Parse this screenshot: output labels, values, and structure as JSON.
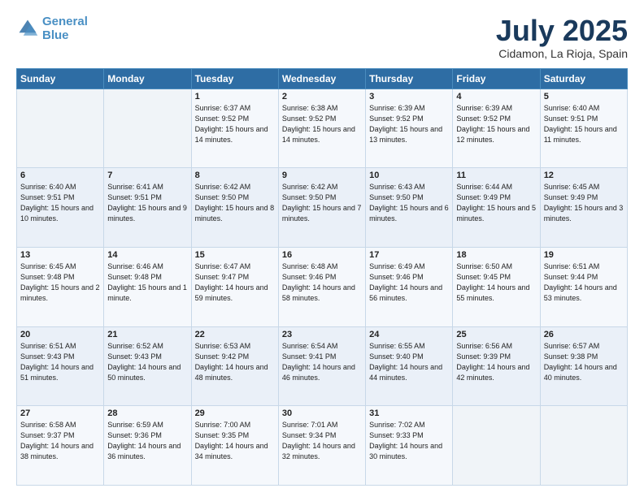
{
  "logo": {
    "text_general": "General",
    "text_blue": "Blue"
  },
  "header": {
    "month": "July 2025",
    "location": "Cidamon, La Rioja, Spain"
  },
  "days_of_week": [
    "Sunday",
    "Monday",
    "Tuesday",
    "Wednesday",
    "Thursday",
    "Friday",
    "Saturday"
  ],
  "weeks": [
    [
      {
        "day": "",
        "sunrise": "",
        "sunset": "",
        "daylight": ""
      },
      {
        "day": "",
        "sunrise": "",
        "sunset": "",
        "daylight": ""
      },
      {
        "day": "1",
        "sunrise": "Sunrise: 6:37 AM",
        "sunset": "Sunset: 9:52 PM",
        "daylight": "Daylight: 15 hours and 14 minutes."
      },
      {
        "day": "2",
        "sunrise": "Sunrise: 6:38 AM",
        "sunset": "Sunset: 9:52 PM",
        "daylight": "Daylight: 15 hours and 14 minutes."
      },
      {
        "day": "3",
        "sunrise": "Sunrise: 6:39 AM",
        "sunset": "Sunset: 9:52 PM",
        "daylight": "Daylight: 15 hours and 13 minutes."
      },
      {
        "day": "4",
        "sunrise": "Sunrise: 6:39 AM",
        "sunset": "Sunset: 9:52 PM",
        "daylight": "Daylight: 15 hours and 12 minutes."
      },
      {
        "day": "5",
        "sunrise": "Sunrise: 6:40 AM",
        "sunset": "Sunset: 9:51 PM",
        "daylight": "Daylight: 15 hours and 11 minutes."
      }
    ],
    [
      {
        "day": "6",
        "sunrise": "Sunrise: 6:40 AM",
        "sunset": "Sunset: 9:51 PM",
        "daylight": "Daylight: 15 hours and 10 minutes."
      },
      {
        "day": "7",
        "sunrise": "Sunrise: 6:41 AM",
        "sunset": "Sunset: 9:51 PM",
        "daylight": "Daylight: 15 hours and 9 minutes."
      },
      {
        "day": "8",
        "sunrise": "Sunrise: 6:42 AM",
        "sunset": "Sunset: 9:50 PM",
        "daylight": "Daylight: 15 hours and 8 minutes."
      },
      {
        "day": "9",
        "sunrise": "Sunrise: 6:42 AM",
        "sunset": "Sunset: 9:50 PM",
        "daylight": "Daylight: 15 hours and 7 minutes."
      },
      {
        "day": "10",
        "sunrise": "Sunrise: 6:43 AM",
        "sunset": "Sunset: 9:50 PM",
        "daylight": "Daylight: 15 hours and 6 minutes."
      },
      {
        "day": "11",
        "sunrise": "Sunrise: 6:44 AM",
        "sunset": "Sunset: 9:49 PM",
        "daylight": "Daylight: 15 hours and 5 minutes."
      },
      {
        "day": "12",
        "sunrise": "Sunrise: 6:45 AM",
        "sunset": "Sunset: 9:49 PM",
        "daylight": "Daylight: 15 hours and 3 minutes."
      }
    ],
    [
      {
        "day": "13",
        "sunrise": "Sunrise: 6:45 AM",
        "sunset": "Sunset: 9:48 PM",
        "daylight": "Daylight: 15 hours and 2 minutes."
      },
      {
        "day": "14",
        "sunrise": "Sunrise: 6:46 AM",
        "sunset": "Sunset: 9:48 PM",
        "daylight": "Daylight: 15 hours and 1 minute."
      },
      {
        "day": "15",
        "sunrise": "Sunrise: 6:47 AM",
        "sunset": "Sunset: 9:47 PM",
        "daylight": "Daylight: 14 hours and 59 minutes."
      },
      {
        "day": "16",
        "sunrise": "Sunrise: 6:48 AM",
        "sunset": "Sunset: 9:46 PM",
        "daylight": "Daylight: 14 hours and 58 minutes."
      },
      {
        "day": "17",
        "sunrise": "Sunrise: 6:49 AM",
        "sunset": "Sunset: 9:46 PM",
        "daylight": "Daylight: 14 hours and 56 minutes."
      },
      {
        "day": "18",
        "sunrise": "Sunrise: 6:50 AM",
        "sunset": "Sunset: 9:45 PM",
        "daylight": "Daylight: 14 hours and 55 minutes."
      },
      {
        "day": "19",
        "sunrise": "Sunrise: 6:51 AM",
        "sunset": "Sunset: 9:44 PM",
        "daylight": "Daylight: 14 hours and 53 minutes."
      }
    ],
    [
      {
        "day": "20",
        "sunrise": "Sunrise: 6:51 AM",
        "sunset": "Sunset: 9:43 PM",
        "daylight": "Daylight: 14 hours and 51 minutes."
      },
      {
        "day": "21",
        "sunrise": "Sunrise: 6:52 AM",
        "sunset": "Sunset: 9:43 PM",
        "daylight": "Daylight: 14 hours and 50 minutes."
      },
      {
        "day": "22",
        "sunrise": "Sunrise: 6:53 AM",
        "sunset": "Sunset: 9:42 PM",
        "daylight": "Daylight: 14 hours and 48 minutes."
      },
      {
        "day": "23",
        "sunrise": "Sunrise: 6:54 AM",
        "sunset": "Sunset: 9:41 PM",
        "daylight": "Daylight: 14 hours and 46 minutes."
      },
      {
        "day": "24",
        "sunrise": "Sunrise: 6:55 AM",
        "sunset": "Sunset: 9:40 PM",
        "daylight": "Daylight: 14 hours and 44 minutes."
      },
      {
        "day": "25",
        "sunrise": "Sunrise: 6:56 AM",
        "sunset": "Sunset: 9:39 PM",
        "daylight": "Daylight: 14 hours and 42 minutes."
      },
      {
        "day": "26",
        "sunrise": "Sunrise: 6:57 AM",
        "sunset": "Sunset: 9:38 PM",
        "daylight": "Daylight: 14 hours and 40 minutes."
      }
    ],
    [
      {
        "day": "27",
        "sunrise": "Sunrise: 6:58 AM",
        "sunset": "Sunset: 9:37 PM",
        "daylight": "Daylight: 14 hours and 38 minutes."
      },
      {
        "day": "28",
        "sunrise": "Sunrise: 6:59 AM",
        "sunset": "Sunset: 9:36 PM",
        "daylight": "Daylight: 14 hours and 36 minutes."
      },
      {
        "day": "29",
        "sunrise": "Sunrise: 7:00 AM",
        "sunset": "Sunset: 9:35 PM",
        "daylight": "Daylight: 14 hours and 34 minutes."
      },
      {
        "day": "30",
        "sunrise": "Sunrise: 7:01 AM",
        "sunset": "Sunset: 9:34 PM",
        "daylight": "Daylight: 14 hours and 32 minutes."
      },
      {
        "day": "31",
        "sunrise": "Sunrise: 7:02 AM",
        "sunset": "Sunset: 9:33 PM",
        "daylight": "Daylight: 14 hours and 30 minutes."
      },
      {
        "day": "",
        "sunrise": "",
        "sunset": "",
        "daylight": ""
      },
      {
        "day": "",
        "sunrise": "",
        "sunset": "",
        "daylight": ""
      }
    ]
  ]
}
